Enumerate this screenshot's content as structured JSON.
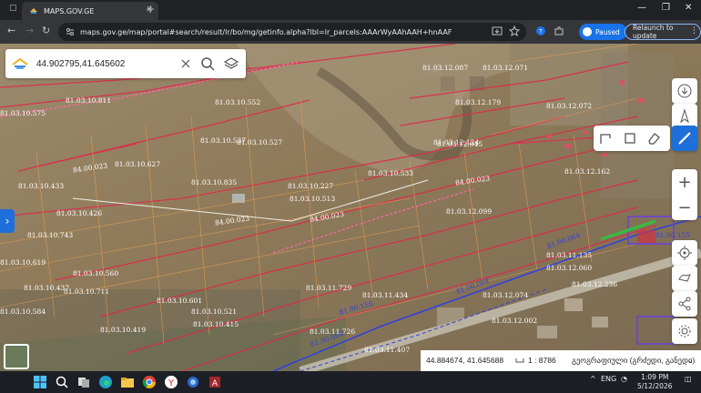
{
  "browser": {
    "tab_title": "MAPS.GOV.GE",
    "url": "maps.gov.ge/map/portal#search/result/lr/bo/mg/getinfo.alpha?lbl=lr_parcels:AAArWyAAhAAH+hnAAF",
    "profile_label": "Paused",
    "relaunch_label": "Relaunch to update"
  },
  "search": {
    "value": "44.902795,41.645602"
  },
  "status": {
    "coords": "44.884674, 41.645688",
    "scale": "1 : 8786",
    "projection": "გეოგრაფიული (გრძედი, განედი)"
  },
  "map_labels": {
    "road_labels": [
      "84.00.023",
      "84.00.023",
      "84.00.023",
      "84.00.023",
      "81.00.064",
      "81.00.064",
      "81.00.064",
      "81.00.155",
      "81.00.155"
    ],
    "parcel_labels": [
      "81.03.10.537",
      "81.03.10.627",
      "81.03.10.227",
      "81.03.10.533",
      "81.03.10.513",
      "81.03.10.426",
      "81.03.10.552",
      "81.03.10.743",
      "81.03.10.811",
      "81.03.10.619",
      "81.03.10.575",
      "81.03.10.560",
      "81.03.10.527",
      "81.03.12.179",
      "81.03.12.162",
      "81.03.12.087",
      "81.03.11.729",
      "81.03.11.135",
      "81.03.12.072",
      "81.03.12.071",
      "81.03.12.045",
      "81.03.10.835",
      "81.03.11.407",
      "81.03.11.434",
      "81.03.10.415",
      "81.03.10.437",
      "81.03.11.726",
      "81.03.10.419",
      "81.03.10.521",
      "81.03.12.060",
      "81.03.12.074",
      "81.03.12.002",
      "81.03.12.124",
      "81.03.10.433",
      "81.03.10.584",
      "81.03.12.236",
      "81.03.10.711",
      "81.03.10.601",
      "81.03.12.099"
    ]
  },
  "taskbar": {
    "time": "1:09 PM",
    "date": "5/12/2026",
    "lang": "ENG"
  }
}
